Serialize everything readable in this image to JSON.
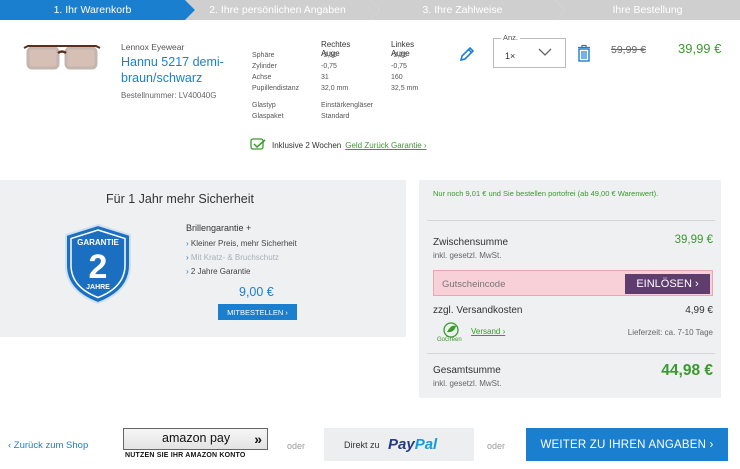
{
  "steps": [
    {
      "label": "1. Ihr Warenkorb",
      "active": true
    },
    {
      "label": "2. Ihre persönlichen Angaben",
      "active": false
    },
    {
      "label": "3. Ihre Zahlweise",
      "active": false
    },
    {
      "label": "Ihre Bestellung",
      "active": false
    }
  ],
  "product": {
    "brand": "Lennox Eyewear",
    "name": "Hannu 5217 demi-braun/schwarz",
    "order_number": "Bestellnummer: LV40040G",
    "right_eye_header": "Rechtes Auge",
    "left_eye_header": "Linkes Auge",
    "specs": [
      {
        "label": "Sphäre",
        "right": "-3,50",
        "left": "-3,25"
      },
      {
        "label": "Zylinder",
        "right": "-0,75",
        "left": "-0,75"
      },
      {
        "label": "Achse",
        "right": "31",
        "left": "160"
      },
      {
        "label": "Pupillendistanz",
        "right": "32,0 mm",
        "left": "32,5 mm"
      }
    ],
    "extras": [
      {
        "label": "Glastyp",
        "value": "Einstärkengläser"
      },
      {
        "label": "Glaspaket",
        "value": "Standard"
      }
    ],
    "guarantee_text": "Inklusive 2 Wochen",
    "guarantee_link": "Geld Zurück Garantie ›",
    "qty_label": "Anz.",
    "qty_value": "1×",
    "old_price": "59,99 €",
    "new_price": "39,99 €"
  },
  "warranty": {
    "title": "Für 1 Jahr mehr Sicherheit",
    "shield_top": "GARANTIE",
    "shield_number": "2",
    "shield_bottom": "JAHRE",
    "name": "Brillengarantie +",
    "features": [
      "Kleiner Preis, mehr Sicherheit",
      "Mit Kratz- & Bruchschutz",
      "2 Jahre Garantie"
    ],
    "price": "9,00 €",
    "button": "MITBESTELLEN ›"
  },
  "summary": {
    "shipping_hint": "Nur noch 9,01 € und Sie bestellen portofrei (ab 49,00 € Warenwert).",
    "subtotal_label": "Zwischensumme",
    "subtotal_sub": "inkl. gesetzl. MwSt.",
    "subtotal_value": "39,99 €",
    "coupon_placeholder": "Gutscheincode",
    "coupon_button": "EINLÖSEN ›",
    "shipping_label": "zzgl. Versandkosten",
    "shipping_value": "4,99 €",
    "green_logo_text": "GoGreen",
    "shipping_link": "Versand ›",
    "delivery_time": "Lieferzeit: ca. 7-10 Tage",
    "total_label": "Gesamtsumme",
    "total_sub": "inkl. gesetzl. MwSt.",
    "total_value": "44,98 €"
  },
  "footer": {
    "back_link": "‹ Zurück zum Shop",
    "amazon_label": "amazon pay",
    "amazon_arrows": "»",
    "amazon_sub": "NUTZEN SIE IHR AMAZON KONTO",
    "or_1": "oder",
    "paypal_prefix": "Direkt zu",
    "paypal_pay": "Pay",
    "paypal_pal": "Pal",
    "or_2": "oder",
    "next_button": "WEITER ZU IHREN ANGABEN ›"
  },
  "colors": {
    "primary_blue": "#1b7fd0",
    "price_green": "#3a9a2c",
    "coupon_button": "#5f3e6f",
    "coupon_highlight": "#f8d1d8"
  }
}
